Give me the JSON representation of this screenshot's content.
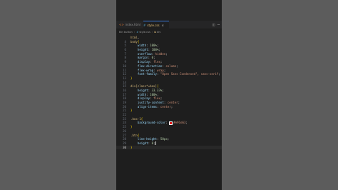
{
  "editor": {
    "tabs": [
      {
        "label": "index.html",
        "icon": "html-file-icon",
        "active": false
      },
      {
        "label": "style.css",
        "icon": "css-file-icon",
        "active": true,
        "close": "×"
      }
    ],
    "actions": [
      "split-editor-icon",
      "more-actions-icon"
    ],
    "breadcrumb": [
      "Bin button",
      "style.css",
      "div"
    ],
    "current_line": 30,
    "colors": {
      "swatch": "#e91515",
      "active_tab_border": "#3a78d6"
    }
  },
  "code": [
    {
      "n": "",
      "text": "html,"
    },
    {
      "n": "4",
      "text": "body{"
    },
    {
      "n": "5",
      "text": "    width: 100%;"
    },
    {
      "n": "6",
      "text": "    height: 100%;"
    },
    {
      "n": "7",
      "text": "    overflow: hidden;"
    },
    {
      "n": "8",
      "text": "    margin: 0;"
    },
    {
      "n": "9",
      "text": "    display: flex;"
    },
    {
      "n": "10",
      "text": "    flex-direction: column;"
    },
    {
      "n": "11",
      "text": "    flex-wrap: wrap;"
    },
    {
      "n": "12",
      "text": "    font-family: \"Open Sans Condensed\", sans-serif;"
    },
    {
      "n": "13",
      "text": "}"
    },
    {
      "n": "14",
      "text": ""
    },
    {
      "n": "15",
      "text": "div[class*=box]{"
    },
    {
      "n": "16",
      "text": "    height: 33.33%;"
    },
    {
      "n": "17",
      "text": "    width: 100%;"
    },
    {
      "n": "18",
      "text": "    display: flex;"
    },
    {
      "n": "19",
      "text": "    justify-content: center;"
    },
    {
      "n": "20",
      "text": "    align-items: center;"
    },
    {
      "n": "21",
      "text": "}"
    },
    {
      "n": "22",
      "text": ""
    },
    {
      "n": "23",
      "text": ".box-1{"
    },
    {
      "n": "24",
      "text": "    background-color: #e91e63;"
    },
    {
      "n": "25",
      "text": "}"
    },
    {
      "n": "26",
      "text": ""
    },
    {
      "n": "27",
      "text": ".btn{"
    },
    {
      "n": "28",
      "text": "    line-height: 50px;"
    },
    {
      "n": "29",
      "text": "    height: 0;"
    },
    {
      "n": "30",
      "text": "}"
    }
  ]
}
